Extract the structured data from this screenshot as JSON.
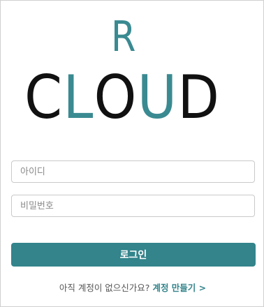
{
  "logo": {
    "top": "R",
    "letters": [
      "C",
      "L",
      "O",
      "U",
      "D"
    ]
  },
  "form": {
    "id_placeholder": "아이디",
    "password_placeholder": "비밀번호",
    "login_label": "로그인"
  },
  "signup": {
    "prompt": "아직 계정이 없으신가요?",
    "link_label": "계정 만들기 >"
  },
  "colors": {
    "accent": "#33848b",
    "logo_teal": "#3a8a91",
    "logo_dark": "#111111"
  }
}
